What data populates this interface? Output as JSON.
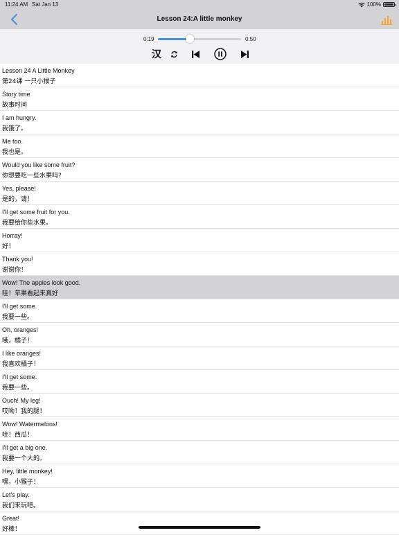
{
  "status": {
    "time": "11:24 AM",
    "date": "Sat Jan 13",
    "battery": "100%"
  },
  "nav": {
    "title": "Lesson 24:A little monkey",
    "accent_color": "#4a90d9",
    "chart_color": "#f5a623"
  },
  "player": {
    "current_time": "0:19",
    "duration": "0:50",
    "progress_fraction": 0.38,
    "lang_toggle": "汉",
    "state": "playing"
  },
  "sentences": [
    {
      "en": "Lesson 24 A Little Monkey",
      "zh": "第24课 一只小猴子"
    },
    {
      "en": "Story time",
      "zh": "故事时间"
    },
    {
      "en": "I am hungry.",
      "zh": "我饿了。"
    },
    {
      "en": "Me too.",
      "zh": "我也是。"
    },
    {
      "en": "Would you like some fruit?",
      "zh": "你想要吃一些水果吗?"
    },
    {
      "en": "Yes, please!",
      "zh": "是的，请！"
    },
    {
      "en": "I'll get some fruit for you.",
      "zh": "我要给你些水果。"
    },
    {
      "en": "Horray!",
      "zh": "好！"
    },
    {
      "en": "Thank you!",
      "zh": "谢谢你！"
    },
    {
      "en": "Wow! The apples look good.",
      "zh": "哇！苹果看起来真好",
      "selected": true
    },
    {
      "en": "I'll get some.",
      "zh": "我要一些。"
    },
    {
      "en": "Oh, oranges!",
      "zh": "哦，橘子！"
    },
    {
      "en": "I like oranges!",
      "zh": "我喜欢橘子！"
    },
    {
      "en": "I'll get some.",
      "zh": "我要一些。"
    },
    {
      "en": "Ouch! My leg!",
      "zh": "哎呦！我的腿！"
    },
    {
      "en": "Wow! Watermelons!",
      "zh": "哇！西瓜！"
    },
    {
      "en": "I'll get a big one.",
      "zh": "我要一个大的。"
    },
    {
      "en": "Hey, little monkey!",
      "zh": "嘿，小猴子！"
    },
    {
      "en": "Let's play.",
      "zh": "我们来玩吧。"
    },
    {
      "en": "Great!",
      "zh": "好棒！"
    }
  ]
}
